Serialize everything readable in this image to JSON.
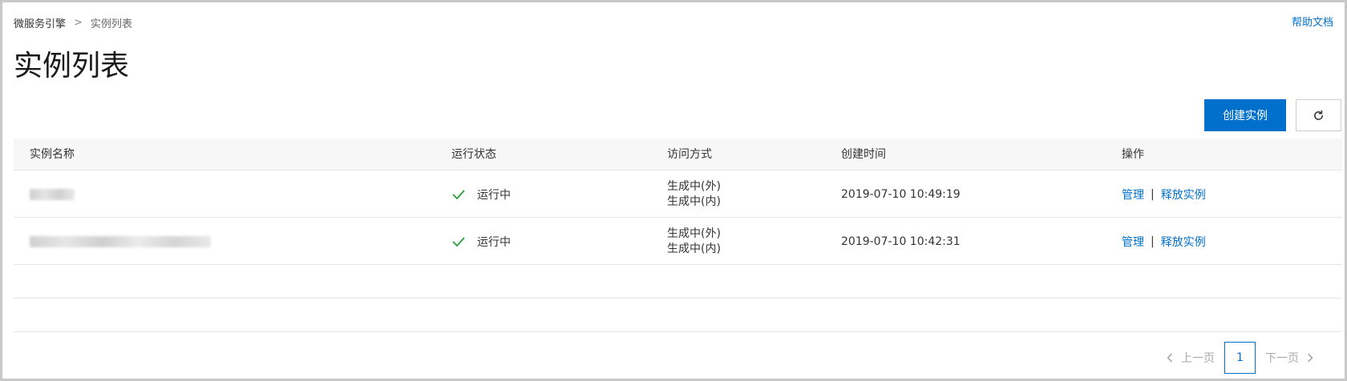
{
  "breadcrumb": {
    "root": "微服务引擎",
    "separator": ">",
    "current": "实例列表"
  },
  "help_link": "帮助文档",
  "page_title": "实例列表",
  "toolbar": {
    "create_label": "创建实例",
    "refresh_icon": "refresh-icon"
  },
  "table": {
    "headers": [
      "实例名称",
      "运行状态",
      "访问方式",
      "创建时间",
      "操作"
    ],
    "rows": [
      {
        "status": "运行中",
        "access_external": "生成中(外)",
        "access_internal": "生成中(内)",
        "created": "2019-07-10 10:49:19",
        "op_manage": "管理",
        "op_sep": "|",
        "op_release": "释放实例"
      },
      {
        "status": "运行中",
        "access_external": "生成中(外)",
        "access_internal": "生成中(内)",
        "created": "2019-07-10 10:42:31",
        "op_manage": "管理",
        "op_sep": "|",
        "op_release": "释放实例"
      }
    ]
  },
  "pagination": {
    "prev": "上一页",
    "current_page": "1",
    "next": "下一页"
  },
  "colors": {
    "accent": "#0070cc",
    "success": "#2a9d3a",
    "header_bg": "#f7f7f7"
  }
}
